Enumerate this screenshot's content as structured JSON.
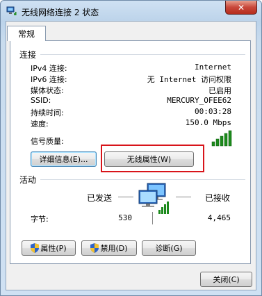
{
  "window": {
    "title": "无线网络连接 2 状态",
    "close_label": "✕"
  },
  "tab": {
    "label": "常规"
  },
  "connection": {
    "title": "连接",
    "rows": [
      {
        "label": "IPv4 连接:",
        "value": "Internet"
      },
      {
        "label": "IPv6 连接:",
        "value": "无 Internet 访问权限"
      },
      {
        "label": "媒体状态:",
        "value": "已启用"
      },
      {
        "label": "SSID:",
        "value": "MERCURY_OFEE62"
      },
      {
        "label": "持续时间:",
        "value": "00:03:28"
      },
      {
        "label": "速度:",
        "value": "150.0 Mbps"
      }
    ],
    "signal_label": "信号质量:",
    "signal_level": 5,
    "details_button": "详细信息(E)...",
    "wireless_props_button": "无线属性(W)"
  },
  "activity": {
    "title": "活动",
    "sent_label": "已发送",
    "received_label": "已接收",
    "bytes_label": "字节:",
    "bytes_sent": "530",
    "bytes_received": "4,465"
  },
  "actions": {
    "properties_button": "属性(P)",
    "disable_button": "禁用(D)",
    "diagnose_button": "诊断(G)"
  },
  "footer": {
    "close_button": "关闭(C)"
  },
  "colors": {
    "highlight_box": "#d8141a",
    "signal_bars": "#1c8a1c"
  }
}
